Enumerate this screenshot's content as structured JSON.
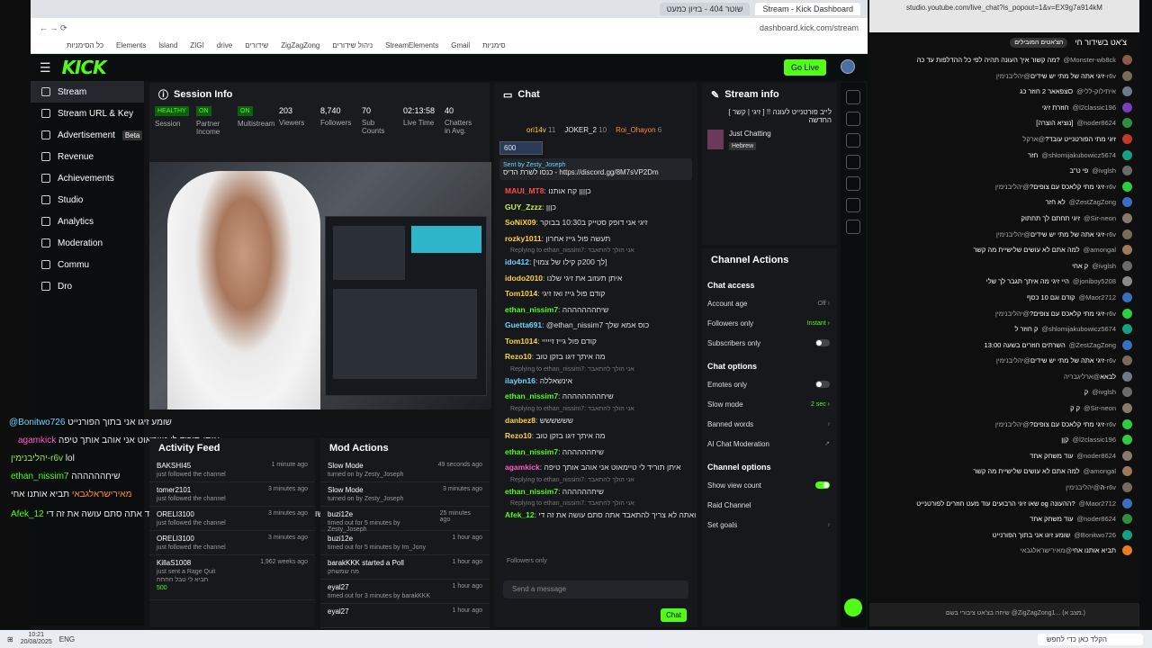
{
  "browser": {
    "tabs": [
      "שוטר 404 - בזיון כמעט",
      "Stream - Kick Dashboard"
    ],
    "url": "dashboard.kick.com/stream",
    "bookmarks": [
      "כל הסימניות",
      "Elements",
      "lsland",
      "ZIGI",
      "drive",
      "שידורים",
      "ZigZagZong",
      "ניהול שידורים",
      "StreamElements",
      "Gmail",
      "סימניות"
    ]
  },
  "kick": {
    "logo": "KICK",
    "go_live": "Go Live",
    "sidebar": [
      {
        "label": "Stream",
        "active": true
      },
      {
        "label": "Stream URL & Key"
      },
      {
        "label": "Advertisement",
        "badge": "Beta"
      },
      {
        "label": "Revenue"
      },
      {
        "label": "Achievements"
      },
      {
        "label": "Studio"
      },
      {
        "label": "Analytics"
      },
      {
        "label": "Moderation"
      },
      {
        "label": "Commu"
      },
      {
        "label": "Dro"
      }
    ],
    "session_info": {
      "title": "Session Info",
      "stats": [
        {
          "badge": "HEALTHY",
          "label": "Session"
        },
        {
          "badge": "ON",
          "label": "Partner Income"
        },
        {
          "badge": "ON",
          "label": "Multistream"
        },
        {
          "value": "203",
          "label": "Viewers"
        },
        {
          "value": "8,740",
          "label": "Followers"
        },
        {
          "value": "70",
          "label": "Sub Counts"
        },
        {
          "value": "02:13:58",
          "label": "Live Time"
        },
        {
          "value": "40",
          "label": "Chatters in Avg."
        }
      ]
    },
    "overlay_chat": [
      {
        "user": "@Bonitwo726",
        "text": "שומע זיגו אני בתוך הפורנייט",
        "color": "#6fd6ff"
      },
      {
        "user": "agamkick",
        "text": "איתן תוריד לי טיימאוט אני אוהב אותך טיפה",
        "color": "#ff5ac8"
      },
      {
        "user": "יהליבנימין-r6v",
        "text": "lol",
        "color": "#9be35a"
      },
      {
        "user": "ethan_nissim7",
        "text": "שיחהההההה",
        "color": "#53fc18"
      },
      {
        "user": "מאירישראלגבאי",
        "text": "תביא אותנו אחי",
        "color": "#ff8a3a"
      },
      {
        "user": "Afek_12",
        "text": "פשוט זה אתה לא תתאבד ואתה לא צריך להתאבד אתה סתם עושה את זה די",
        "color": "#53fc18"
      }
    ],
    "activity_feed": {
      "title": "Activity Feed",
      "items": [
        {
          "name": "BAKSHI45",
          "sub": "just followed the channel",
          "time": "1 minute ago"
        },
        {
          "name": "tomer2101",
          "sub": "just followed the channel",
          "time": "3 minutes ago"
        },
        {
          "name": "ORELI3100",
          "sub": "just followed the channel",
          "time": "3 minutes ago"
        },
        {
          "name": "ORELI3100",
          "sub": "just followed the channel",
          "time": "3 minutes ago"
        },
        {
          "name": "KillaS1008",
          "sub": "just sent a Rage Quit",
          "time": "1,962 weeks ago"
        }
      ],
      "gift_note": "תביא לי טבל חחחח",
      "gift_amount": "500"
    },
    "mod_actions": {
      "title": "Mod Actions",
      "items": [
        {
          "name": "Slow Mode",
          "sub": "turned on by Zesty_Joseph",
          "time": "49 seconds ago"
        },
        {
          "name": "Slow Mode",
          "sub": "turned on by Zesty_Joseph",
          "time": "3 minutes ago"
        },
        {
          "name": "buzi12e",
          "sub": "timed out for 5 minutes by Zesty_Joseph",
          "time": "25 minutes ago"
        },
        {
          "name": "buzi12e",
          "sub": "timed out for 5 minutes by Im_Jony",
          "time": "1 hour ago"
        },
        {
          "name": "barakKKK started a Poll",
          "sub": "מה שמשחק",
          "time": "1 hour ago"
        },
        {
          "name": "eyal27",
          "sub": "timed out for 3 minutes by barakKKK",
          "time": "1 hour ago"
        },
        {
          "name": "eyal27",
          "sub": "",
          "time": "1 hour ago"
        }
      ]
    },
    "chat": {
      "title": "Chat",
      "top_gifters": [
        {
          "name": "ori14v",
          "count": "11"
        },
        {
          "name": "JOKER_2",
          "count": "10"
        },
        {
          "name": "Roi_Ohayon",
          "count": "6"
        }
      ],
      "goal": "600",
      "pinned_by": "Sent by Zesty_Joseph",
      "pinned_text": "כנסו לשרת הדיס - https://discord.gg/8M7sVP2Dm",
      "messages": [
        {
          "user": "MAUI_MT8",
          "text": "כןןןן קח אותנו",
          "color": "#ff4d4d"
        },
        {
          "user": "GUY_Zzzz",
          "text": "כןןן",
          "color": "#c9f542"
        },
        {
          "user": "SoNiX09",
          "text": "זיגי אני דופק סטייק ב10:30 בבוקר",
          "color": "#ffd23f"
        },
        {
          "user": "rozky1011",
          "text": "תעשה פול גייז אחרון",
          "color": "#ffd23f"
        },
        {
          "reply": "Replying to ethan_nissim7: אני הולך להתאבד"
        },
        {
          "user": "ido412",
          "text": "[לך 200ק קילו של צמוי]",
          "color": "#6fd6ff"
        },
        {
          "user": "idodo2010",
          "text": "איתן תעזוב את זיגי שלנו",
          "color": "#ffd23f"
        },
        {
          "user": "Tom1014",
          "text": "קודם פול גייז ואז זיגי",
          "color": "#ffd23f"
        },
        {
          "user": "ethan_nissim7",
          "text": "שיחההההההה",
          "color": "#53fc18"
        },
        {
          "user": "Guetta691",
          "text": "@ethan_nissim7 כוס אמא שלך",
          "color": "#6fd6ff"
        },
        {
          "user": "Tom1014",
          "text": "קודם פול גייז זייייי",
          "color": "#ffd23f"
        },
        {
          "user": "Rezo10",
          "text": "מה איתך זיגו בזקן טוב",
          "color": "#ffd23f"
        },
        {
          "reply": "Replying to ethan_nissim7: אני הולך להתאבד"
        },
        {
          "user": "ilaybn16",
          "text": "אינשאללה",
          "color": "#6fd6ff"
        },
        {
          "user": "ethan_nissim7",
          "text": "שיחהההההההה",
          "color": "#53fc18"
        },
        {
          "reply": "Replying to ethan_nissim7: אני הולך להתאבד"
        },
        {
          "user": "danbez8",
          "text": "שששששש",
          "color": "#ffd23f"
        },
        {
          "user": "Rezo10",
          "text": "מה איתך זיגו בזקן טוב",
          "color": "#ffd23f"
        },
        {
          "user": "ethan_nissim7",
          "text": "שיחהההההה",
          "color": "#53fc18"
        },
        {
          "user": "agamkick",
          "text": "איתן תוריד לי טיימאוט אני אוהב אותך טיפה",
          "color": "#ff5ac8"
        },
        {
          "reply": "Replying to ethan_nissim7: אני הולך להתאבד"
        },
        {
          "user": "ethan_nissim7",
          "text": "שיחהההההה",
          "color": "#53fc18"
        },
        {
          "reply": "Replying to ethan_nissim7: אני הולך להתאבד"
        },
        {
          "user": "Afek_12",
          "text": "אבל די זה זה די זה פשוט די אתה לא תתאבד ואתה לא צריך להתאבד אתה סתם עושה את זה די",
          "color": "#53fc18"
        }
      ],
      "followers_only": "Followers only",
      "input_placeholder": "Send a message",
      "send_label": "Chat"
    },
    "stream_info": {
      "title": "Stream info",
      "stream_title": "[ זיגי | קשר ] !! לייב פורטנייט לעונה החדשה",
      "category": "Just Chatting",
      "tag": "Hebrew"
    },
    "channel_actions": {
      "title": "Channel Actions",
      "sections": [
        {
          "heading": "Chat access",
          "rows": [
            {
              "label": "Account age",
              "value": "Off",
              "kind": "arrow"
            },
            {
              "label": "Followers only",
              "value": "Instant",
              "kind": "arrow",
              "green": true
            },
            {
              "label": "Subscribers only",
              "kind": "toggle",
              "on": false
            }
          ]
        },
        {
          "heading": "Chat options",
          "rows": [
            {
              "label": "Emotes only",
              "kind": "toggle",
              "on": false
            },
            {
              "label": "Slow mode",
              "value": "2 sec",
              "kind": "arrow",
              "green": true
            },
            {
              "label": "Banned words",
              "kind": "arrow"
            },
            {
              "label": "AI Chat Moderation",
              "kind": "ext"
            }
          ]
        },
        {
          "heading": "Channel options",
          "rows": [
            {
              "label": "Show view count",
              "kind": "toggle",
              "on": true
            },
            {
              "label": "Raid Channel",
              "kind": "none"
            },
            {
              "label": "Set goals",
              "kind": "arrow"
            }
          ]
        }
      ]
    }
  },
  "youtube": {
    "url": "studio.youtube.com/live_chat?is_popout=1&v=EX9g7a914kM",
    "title": "צ'אט בשידור חי",
    "top_label": "הצ'אטים המובילים",
    "messages": [
      {
        "n": "@Monster-wb8ck",
        "t": "מה קשור איך העונה תהיה לפי כל ההדלפות עד כה?",
        "c": "#8a5a4a"
      },
      {
        "n": "@יהליבנימין-r6v",
        "t": "זיגי אתה של מתי יש שידים",
        "c": "#7a6a5a"
      },
      {
        "n": "@איתילוק-ללי",
        "t": "צפאאר 2 חוזר כגO",
        "c": "#6b7b8b"
      },
      {
        "n": "@l2classic196",
        "t": "חוזרת זיגי",
        "c": "#7a3fbf"
      },
      {
        "n": "@noder8624",
        "t": "[נוציא הוצרה]",
        "c": "#2f8f3f"
      },
      {
        "n": "@ארקל",
        "t": "זיגי מתי הפורטנייט עובד?",
        "c": "#c0392b"
      },
      {
        "n": "@shlomijakubowicz5674",
        "t": "חזר",
        "c": "#16a085"
      },
      {
        "n": "@ivglsh",
        "t": "פי ט\"ב",
        "c": "#6b6b6b"
      },
      {
        "n": "@יהליבנימין-r6v",
        "t": "זיגי מתי קלאכס עם צופים?",
        "c": "#2ecc40"
      },
      {
        "n": "@ZestZagZong",
        "t": "לא חזר",
        "c": "#3a6fbf"
      },
      {
        "n": "@Sir-neon",
        "t": "זיגי תחתם לך תחתוק",
        "c": "#8a7a6a"
      },
      {
        "n": "@יהליבנימין-r6v",
        "t": "זיגי אתה של מתי יש שידים",
        "c": "#7a6a5a"
      },
      {
        "n": "@amongal",
        "t": "למה אתם לא עושים שלישיית מה קשר",
        "c": "#a0785a"
      },
      {
        "n": "@ivglsh",
        "t": "ק אחי",
        "c": "#6b6b6b"
      },
      {
        "n": "@joniboy5208",
        "t": "היי זיגי מה איתך תגבר לך שלי",
        "c": "#8a8a8a"
      },
      {
        "n": "@Maor2712",
        "t": "קודם וגם 10 כסף",
        "c": "#3a6fbf"
      },
      {
        "n": "@יהליבנימין-r6v",
        "t": "זיגי מתי קלאכס עם צופים?",
        "c": "#2ecc40"
      },
      {
        "n": "@shlomijakubowicz5674",
        "t": "ק חוזר ל",
        "c": "#16a085"
      },
      {
        "n": "@ZestZagZong",
        "t": "השרתים חוזרים בשעה 13:00",
        "c": "#3a6fbf"
      },
      {
        "n": "@יהליבנימין-r6v",
        "t": "זיגי אתה של מתי יש שידים",
        "c": "#7a6a5a"
      },
      {
        "n": "@ארליגבריה",
        "t": "לבאא",
        "c": "#6b7b8b"
      },
      {
        "n": "@ivglsh",
        "t": "ק",
        "c": "#6b6b6b"
      },
      {
        "n": "@Sir-neon",
        "t": "ק ק",
        "c": "#8a7a6a"
      },
      {
        "n": "@יהליבנימין-r6v",
        "t": "זיגי מתי קלאכס עם צופים?",
        "c": "#2ecc40"
      },
      {
        "n": "@l2classic196",
        "t": "קןן",
        "c": "#2ecc40"
      },
      {
        "n": "@noder8624",
        "t": "עוד משחק אחד",
        "c": "#8a7a6a"
      },
      {
        "n": "@amongal",
        "t": "למה אתם לא עושים שלישיית מה קשר",
        "c": "#a0785a"
      },
      {
        "n": "@יהליבנימין-r6v",
        "t": "ה",
        "c": "#7a6a5a"
      },
      {
        "n": "@Maor2712",
        "t": "שאו זיגי הרבועים עוד מעט חוזרים לפורטנייט og ההעונה?",
        "c": "#3a6fbf"
      },
      {
        "n": "@noder8624",
        "t": "עוד משחק אחד",
        "c": "#2f8f3f"
      },
      {
        "n": "@Bonitwo726",
        "t": "שומע זיגו אני בתוך הפורנייט",
        "c": "#16a085"
      },
      {
        "n": "@מאירישראלגבאי",
        "t": "תביא אותנו אחי",
        "c": "#e67e22"
      }
    ],
    "input_placeholder": "שיחה בצ'אט ציבורי בשם @ZigZagZong1... (מצב א.)"
  },
  "taskbar": {
    "time": "10:21",
    "date": "20/08/2025",
    "lang": "ENG",
    "search": "הקלד כאן כדי לחפש"
  }
}
